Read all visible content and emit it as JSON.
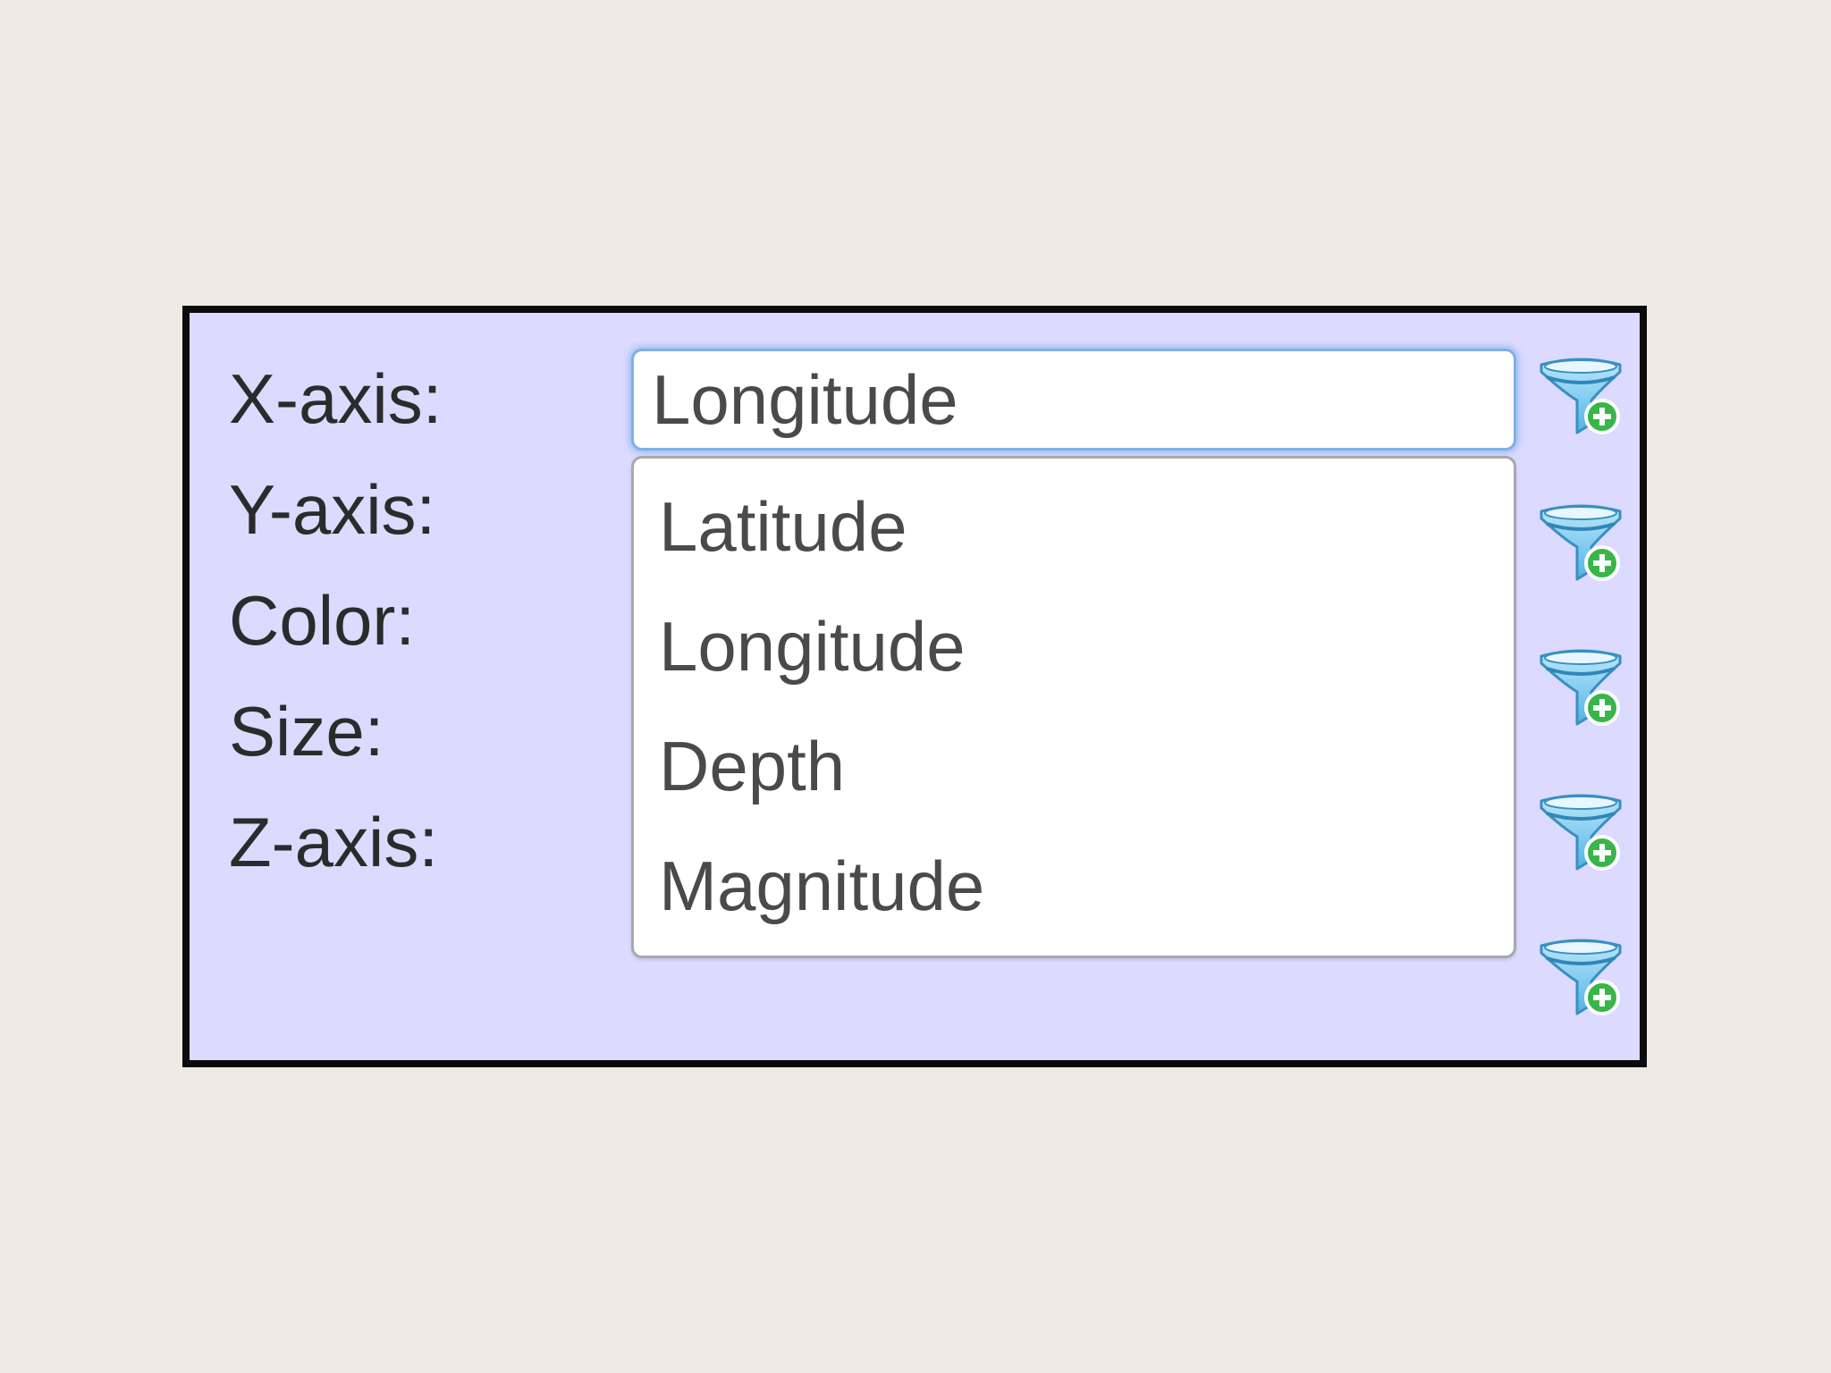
{
  "rows": [
    {
      "label": "X-axis:",
      "value": "Longitude",
      "focused": true
    },
    {
      "label": "Y-axis:",
      "value": ""
    },
    {
      "label": "Color:",
      "value": ""
    },
    {
      "label": "Size:",
      "value": ""
    },
    {
      "label": "Z-axis:",
      "value": ""
    }
  ],
  "dropdown": {
    "options": [
      "Latitude",
      "Longitude",
      "Depth",
      "Magnitude"
    ]
  },
  "icons": {
    "row_button": "filter-add-icon"
  },
  "colors": {
    "panel_background": "#dcdaff",
    "panel_border": "#0c0c0c",
    "page_background": "#f0eae5",
    "focus_ring": "#7fb1e0",
    "filter_icon_blue": "#4fb3e6",
    "add_badge_green": "#39b54a"
  }
}
